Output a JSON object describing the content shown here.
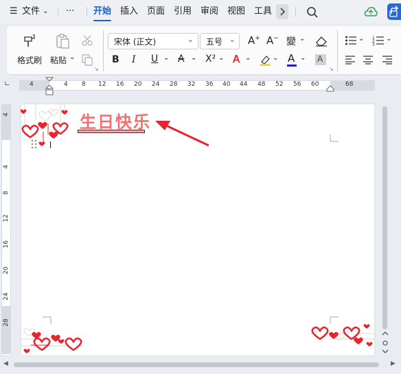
{
  "menu": {
    "file": "文件",
    "more": "···",
    "tabs": [
      "开始",
      "插入",
      "页面",
      "引用",
      "审阅",
      "视图",
      "工具"
    ],
    "active_tab": "开始"
  },
  "ribbon": {
    "format_painter": "格式刷",
    "paste": "粘贴",
    "font_name": "宋体 (正文)",
    "font_size": "五号",
    "superscript": "X²"
  },
  "ruler": {
    "h_ticks": [
      "4",
      "4",
      "8",
      "12",
      "16",
      "20",
      "24",
      "28",
      "32",
      "36",
      "40",
      "44",
      "48",
      "52",
      "56",
      "60",
      "68"
    ],
    "v_ticks": [
      "4",
      "4",
      "8",
      "12",
      "16",
      "20",
      "24",
      "28"
    ]
  },
  "document": {
    "title_text": "生日快乐"
  },
  "colors": {
    "accent": "#1a5fd6",
    "title": "#f2706f",
    "arrow": "#e8242e",
    "heart": "#e8242e"
  }
}
